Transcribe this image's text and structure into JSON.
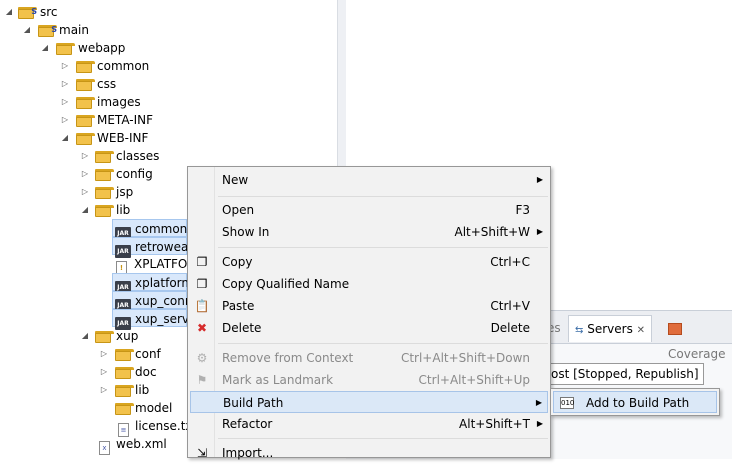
{
  "tree": {
    "items": [
      {
        "label": "src",
        "icon": "package-folder-icon",
        "twisty": "expanded"
      },
      {
        "label": "main",
        "icon": "package-folder-icon",
        "twisty": "expanded"
      },
      {
        "label": "webapp",
        "icon": "folder-icon",
        "twisty": "expanded"
      },
      {
        "label": "common",
        "icon": "folder-icon",
        "twisty": "collapsed"
      },
      {
        "label": "css",
        "icon": "folder-icon",
        "twisty": "collapsed"
      },
      {
        "label": "images",
        "icon": "folder-icon",
        "twisty": "collapsed"
      },
      {
        "label": "META-INF",
        "icon": "folder-icon",
        "twisty": "collapsed"
      },
      {
        "label": "WEB-INF",
        "icon": "folder-icon",
        "twisty": "expanded"
      },
      {
        "label": "classes",
        "icon": "folder-icon",
        "twisty": "collapsed"
      },
      {
        "label": "config",
        "icon": "folder-icon",
        "twisty": "collapsed"
      },
      {
        "label": "jsp",
        "icon": "folder-icon",
        "twisty": "collapsed"
      },
      {
        "label": "lib",
        "icon": "folder-icon",
        "twisty": "expanded"
      },
      {
        "label": "commons",
        "icon": "jar-icon",
        "selected": true
      },
      {
        "label": "retroweav",
        "icon": "jar-icon",
        "selected": true
      },
      {
        "label": "XPLATFOI",
        "icon": "warning-file-icon"
      },
      {
        "label": "xplatform",
        "icon": "jar-icon",
        "selected": true
      },
      {
        "label": "xup_conn",
        "icon": "jar-icon",
        "selected": true
      },
      {
        "label": "xup_servic",
        "icon": "jar-icon",
        "selected": true
      },
      {
        "label": "xup",
        "icon": "folder-icon",
        "twisty": "expanded"
      },
      {
        "label": "conf",
        "icon": "folder-icon",
        "twisty": "collapsed"
      },
      {
        "label": "doc",
        "icon": "folder-icon",
        "twisty": "collapsed"
      },
      {
        "label": "lib",
        "icon": "folder-icon",
        "twisty": "collapsed"
      },
      {
        "label": "model",
        "icon": "folder-icon"
      },
      {
        "label": "license.txt",
        "icon": "text-file-icon"
      },
      {
        "label": "web.xml",
        "icon": "xml-file-icon"
      }
    ]
  },
  "panel": {
    "tabs": [
      {
        "label": "es",
        "active": false
      },
      {
        "label": "Servers",
        "active": true,
        "close": "✕"
      },
      {
        "label": "Coverage",
        "active": false
      }
    ],
    "server_status": "ost  [Stopped, Republish]"
  },
  "menu": {
    "items": [
      {
        "label": "New",
        "shortcut": "",
        "arrow": "▶"
      },
      {
        "label": "Open",
        "shortcut": "F3"
      },
      {
        "label": "Show In",
        "shortcut": "Alt+Shift+W",
        "arrow": "▶"
      },
      {
        "label": "Copy",
        "shortcut": "Ctrl+C",
        "icon": "copy-icon"
      },
      {
        "label": "Copy Qualified Name",
        "shortcut": "",
        "icon": "copy-qualified-icon"
      },
      {
        "label": "Paste",
        "shortcut": "Ctrl+V",
        "icon": "paste-icon"
      },
      {
        "label": "Delete",
        "shortcut": "Delete",
        "icon": "delete-icon"
      },
      {
        "label": "Remove from Context",
        "shortcut": "Ctrl+Alt+Shift+Down",
        "disabled": true,
        "icon": "remove-context-icon"
      },
      {
        "label": "Mark as Landmark",
        "shortcut": "Ctrl+Alt+Shift+Up",
        "disabled": true,
        "icon": "landmark-icon"
      },
      {
        "label": "Build Path",
        "shortcut": "",
        "arrow": "▶",
        "highlight": true
      },
      {
        "label": "Refactor",
        "shortcut": "Alt+Shift+T",
        "arrow": "▶"
      },
      {
        "label": "Import...",
        "shortcut": "",
        "icon": "import-icon"
      }
    ]
  },
  "submenu": {
    "items": [
      {
        "label": "Add to Build Path",
        "icon": "build-path-icon"
      }
    ]
  },
  "colors": {
    "accent": "#dbe8f7",
    "folder": "#f2c24b",
    "delete": "#d62b2b"
  }
}
